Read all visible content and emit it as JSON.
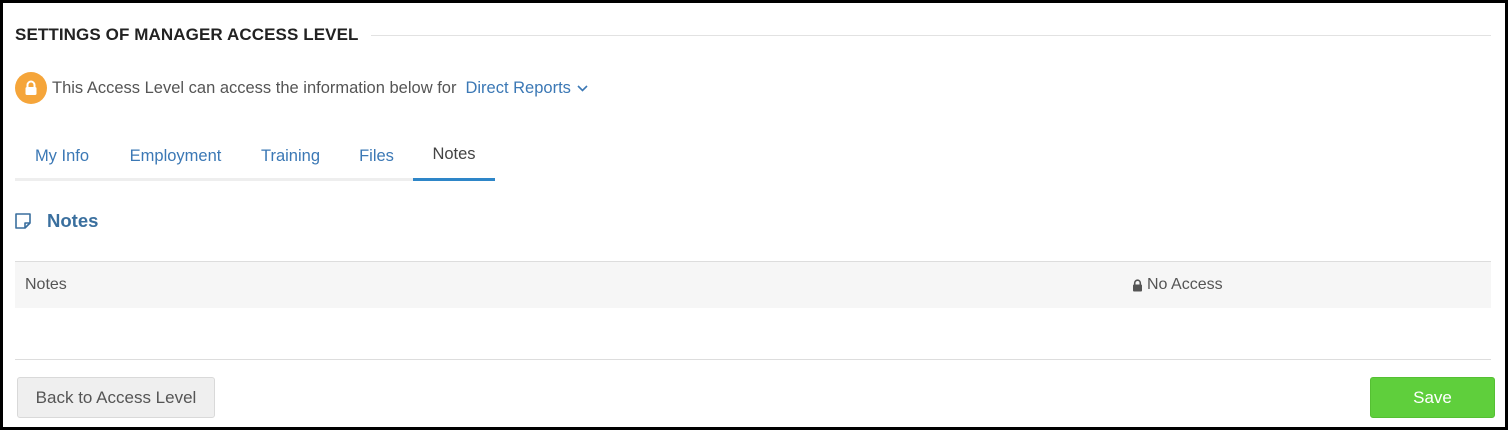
{
  "header": {
    "title": "SETTINGS OF MANAGER ACCESS LEVEL"
  },
  "access": {
    "icon": "lock-icon",
    "badge_color": "#f5a53a",
    "description": "This Access Level can access the information below for",
    "scope_selected": "Direct Reports"
  },
  "tabs": [
    {
      "label": "My Info",
      "active": false
    },
    {
      "label": "Employment",
      "active": false
    },
    {
      "label": "Training",
      "active": false
    },
    {
      "label": "Files",
      "active": false
    },
    {
      "label": "Notes",
      "active": true
    }
  ],
  "section": {
    "icon": "note-icon",
    "title": "Notes"
  },
  "permissions": [
    {
      "label": "Notes",
      "value": "No Access",
      "icon": "lock-icon"
    }
  ],
  "footer": {
    "back_label": "Back to Access Level",
    "save_label": "Save",
    "save_color": "#5fcf3c"
  }
}
